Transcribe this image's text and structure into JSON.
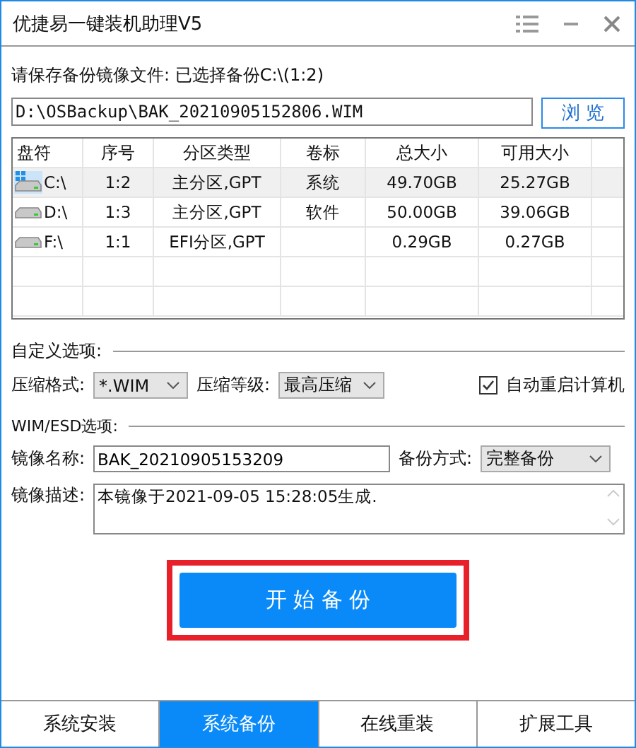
{
  "window": {
    "title": "优捷易一键装机助理V5"
  },
  "prompt": "请保存备份镜像文件: 已选择备份C:\\(1:2)",
  "path": {
    "value": "D:\\OSBackup\\BAK_20210905152806.WIM"
  },
  "browse_button": "浏 览",
  "table": {
    "columns": [
      "盘符",
      "序号",
      "分区类型",
      "卷标",
      "总大小",
      "可用大小"
    ],
    "rows": [
      {
        "kind": "system",
        "selected": true,
        "cells": [
          "C:\\",
          "1:2",
          "主分区,GPT",
          "系统",
          "49.70GB",
          "25.27GB"
        ]
      },
      {
        "kind": "disk",
        "selected": false,
        "cells": [
          "D:\\",
          "1:3",
          "主分区,GPT",
          "软件",
          "50.00GB",
          "39.06GB"
        ]
      },
      {
        "kind": "disk",
        "selected": false,
        "cells": [
          "F:\\",
          "1:1",
          "EFI分区,GPT",
          "",
          "0.29GB",
          "0.27GB"
        ]
      }
    ]
  },
  "custom_options": {
    "heading": "自定义选项:",
    "format_label": "压缩格式:",
    "format_value": "*.WIM",
    "level_label": "压缩等级:",
    "level_value": "最高压缩",
    "reboot": {
      "label": "自动重启计算机",
      "checked": true
    }
  },
  "wim_options": {
    "heading": "WIM/ESD选项:",
    "name_label": "镜像名称:",
    "name_value": "BAK_20210905153209",
    "mode_label": "备份方式:",
    "mode_value": "完整备份",
    "desc_label": "镜像描述:",
    "desc_value": "本镜像于2021-09-05 15:28:05生成."
  },
  "start_button": {
    "label": "开 始 备 份",
    "highlighted": true
  },
  "tabs": [
    {
      "label": "系统安装",
      "selected": false
    },
    {
      "label": "系统备份",
      "selected": true
    },
    {
      "label": "在线重装",
      "selected": false
    },
    {
      "label": "扩展工具",
      "selected": false
    }
  ]
}
